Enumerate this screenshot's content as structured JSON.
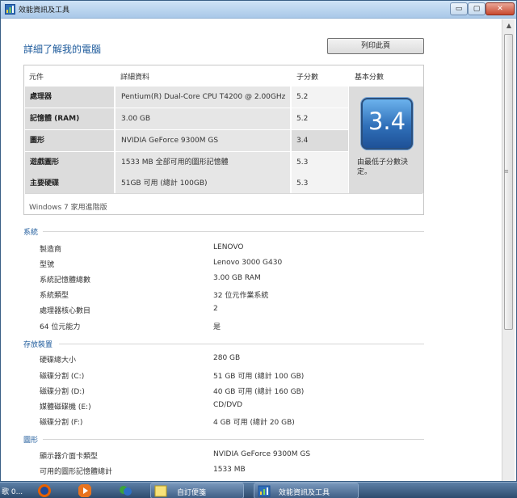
{
  "window": {
    "title": "效能資訊及工具",
    "controls": {
      "minimize": "▭",
      "maximize": "▢",
      "close": "✕"
    }
  },
  "page_title": "詳細了解我的電腦",
  "print_button": "列印此頁",
  "score_table": {
    "headers": {
      "component": "元件",
      "details": "詳細資料",
      "subscore": "子分數",
      "base_score": "基本分數"
    },
    "rows": [
      {
        "component": "處理器",
        "details": "Pentium(R) Dual-Core CPU T4200 @ 2.00GHz",
        "subscore": "5.2"
      },
      {
        "component": "記憶體 (RAM)",
        "details": "3.00 GB",
        "subscore": "5.2"
      },
      {
        "component": "圖形",
        "details": "NVIDIA GeForce 9300M GS",
        "subscore": "3.4"
      },
      {
        "component": "遊戲圖形",
        "details": "1533 MB 全部可用的圖形記憶體",
        "subscore": "5.3"
      },
      {
        "component": "主要硬碟",
        "details": "51GB 可用 (總計 100GB)",
        "subscore": "5.3"
      }
    ],
    "base_score": "3.4",
    "base_score_note": "由最低子分數決定。",
    "edition": "Windows 7 家用進階版"
  },
  "system": {
    "heading": "系統",
    "items": [
      {
        "label": "製造商",
        "value": "LENOVO"
      },
      {
        "label": "型號",
        "value": "Lenovo 3000 G430"
      },
      {
        "label": "系統記憶體總數",
        "value": "3.00 GB RAM"
      },
      {
        "label": "系統類型",
        "value": "32 位元作業系統"
      },
      {
        "label": "處理器核心數目",
        "value": "2"
      },
      {
        "label": "64 位元能力",
        "value": "是"
      }
    ]
  },
  "storage": {
    "heading": "存放裝置",
    "items": [
      {
        "label": "硬碟總大小",
        "value": "280 GB"
      },
      {
        "label": "磁碟分割 (C:)",
        "value": "51 GB 可用 (總計 100 GB)"
      },
      {
        "label": "磁碟分割 (D:)",
        "value": "40 GB 可用 (總計 160 GB)"
      },
      {
        "label": "媒體磁碟機 (E:)",
        "value": "CD/DVD"
      },
      {
        "label": "磁碟分割 (F:)",
        "value": "4 GB 可用 (總計 20 GB)"
      }
    ]
  },
  "graphics": {
    "heading": "圖形",
    "items": [
      {
        "label": "顯示器介面卡類型",
        "value": "NVIDIA GeForce 9300M GS"
      },
      {
        "label": "可用的圖形記憶體總計",
        "value": "1533 MB"
      }
    ]
  },
  "taskbar": {
    "left_text": "歌 0...",
    "items": [
      {
        "label": "自訂便箋",
        "icon": "notes-icon"
      },
      {
        "label": "效能資訊及工具",
        "icon": "performance-icon"
      }
    ]
  },
  "colors": {
    "heading": "#1d5a9b",
    "badge": "#2f6fb8",
    "taskbar": "#3f5f86"
  }
}
